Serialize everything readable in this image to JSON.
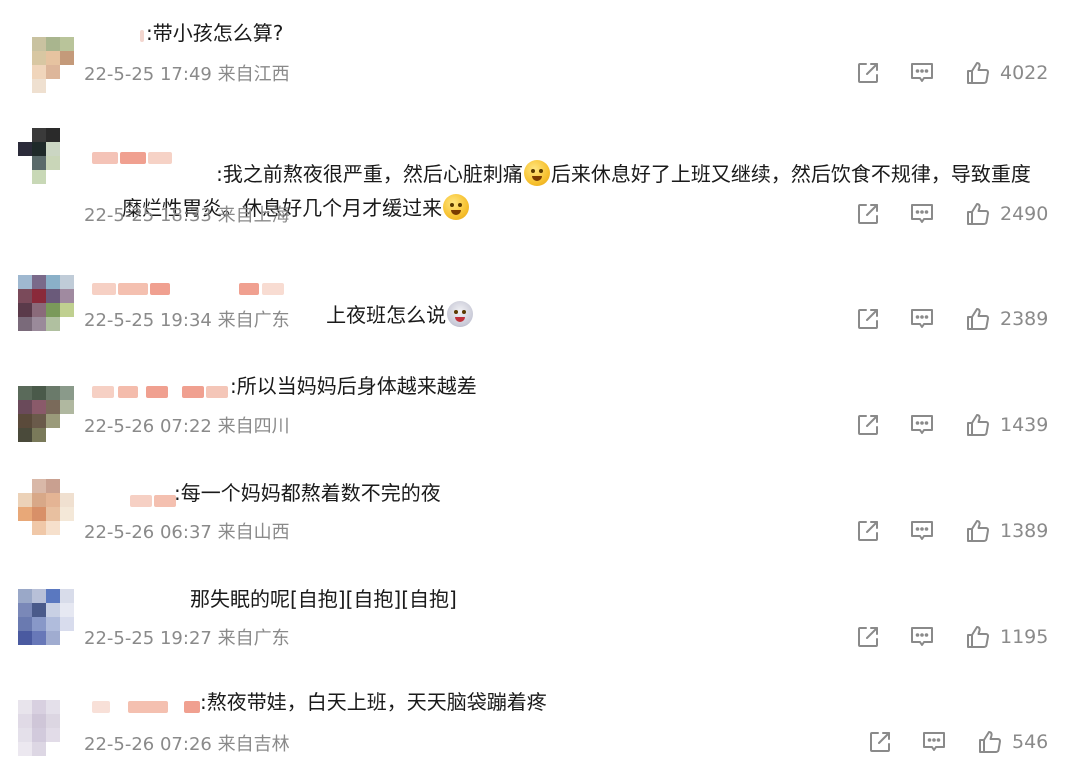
{
  "comments": [
    {
      "text_html": ":带小孩怎么算?",
      "time": "22-5-25 17:49",
      "location": "来自江西",
      "likes": "4022",
      "avatar_colors": [
        "#ffffff",
        "#c9c2a0",
        "#a9b58e",
        "#b9c49a",
        "#ffffff",
        "#d8c7a2",
        "#e6c3a0",
        "#c49a7a",
        "#ffffff",
        "#f0d5bb",
        "#ddb69a",
        "#ffffff",
        "#ffffff",
        "#efe0d0",
        "#ffffff",
        "#ffffff"
      ]
    },
    {
      "text_line1": ":我之前熬夜很严重，然后心脏刺痛",
      "text_line1b": "后来休息好了上班又继续，然后饮食不规律，导致重度",
      "text_line2": "糜烂性胃炎。休息好几个月才缓过来",
      "time": "22-5-25 18:33",
      "location": "来自上海",
      "likes": "2490",
      "avatar_colors": [
        "#ffffff",
        "#3a3a3a",
        "#2a2a2a",
        "#ffffff",
        "#2b2b3a",
        "#1f2a2a",
        "#cbd6c3",
        "#ffffff",
        "#ffffff",
        "#5a6a6a",
        "#c9d6b8",
        "#ffffff",
        "#ffffff",
        "#c8d8b6",
        "#ffffff",
        "#ffffff"
      ]
    },
    {
      "text": "上夜班怎么说",
      "time": "22-5-25 19:34",
      "location": "来自广东",
      "likes": "2389",
      "avatar_colors": [
        "#9fb8d0",
        "#7a6a8a",
        "#8ab0c8",
        "#c0ccd8",
        "#7a4a5a",
        "#8a2a3a",
        "#6a5a7a",
        "#a08aa0",
        "#5a3a4a",
        "#8a6a7a",
        "#7a9a5a",
        "#c0d090",
        "#7a6a7a",
        "#9a8a9a",
        "#b0c0a0",
        "#ffffff"
      ]
    },
    {
      "text": ":所以当妈妈后身体越来越差",
      "time": "22-5-26 07:22",
      "location": "来自四川",
      "likes": "1439",
      "avatar_colors": [
        "#5a6a5a",
        "#4a5a4a",
        "#6a7a6a",
        "#8a9a8a",
        "#6a4a5a",
        "#8a5a6a",
        "#7a6a5a",
        "#b0b8a0",
        "#5a4a3a",
        "#6a5a4a",
        "#9a9a7a",
        "#ffffff",
        "#4a4a3a",
        "#7a7a5a",
        "#ffffff",
        "#ffffff"
      ]
    },
    {
      "text": ":每一个妈妈都熬着数不完的夜",
      "time": "22-5-26 06:37",
      "location": "来自山西",
      "likes": "1389",
      "avatar_colors": [
        "#ffffff",
        "#d9b8a8",
        "#c9a090",
        "#ffffff",
        "#ecd2b8",
        "#d8a888",
        "#e4b494",
        "#f0e0d0",
        "#e8a878",
        "#d89068",
        "#e8c0a0",
        "#f4e8d8",
        "#ffffff",
        "#f0c8a8",
        "#f6e0cc",
        "#ffffff"
      ]
    },
    {
      "text": "那失眠的呢[自抱][自抱][自抱]",
      "time": "22-5-25 19:27",
      "location": "来自广东",
      "likes": "1195",
      "avatar_colors": [
        "#9aa8c8",
        "#b8c0d8",
        "#5a78c0",
        "#d8dcea",
        "#7a88b8",
        "#4a5a8a",
        "#c8d0e4",
        "#e6e8f2",
        "#6a7ab0",
        "#8898c8",
        "#b0bcdc",
        "#d8dced",
        "#4a5aa0",
        "#6878b8",
        "#a0acd0",
        "#ffffff"
      ]
    },
    {
      "text": ":熬夜带娃，白天上班，天天脑袋蹦着疼",
      "time": "22-5-26 07:26",
      "location": "来自吉林",
      "likes": "546",
      "avatar_colors": [
        "#e8e4ec",
        "#d8d0e0",
        "#e4e0ea",
        "#ffffff",
        "#e0dae6",
        "#cfc6d8",
        "#dcd6e2",
        "#ffffff",
        "#e4e0ea",
        "#d2cadc",
        "#e2dce8",
        "#ffffff",
        "#ece8f0",
        "#ddd7e4",
        "#ffffff",
        "#ffffff"
      ]
    }
  ],
  "icons": {
    "share": "share-icon",
    "comment": "comment-icon",
    "like": "thumbs-up-icon"
  },
  "colors": {
    "text": "#1a1a1a",
    "meta": "#8a8a8a",
    "blur_red": "#f0a090"
  }
}
